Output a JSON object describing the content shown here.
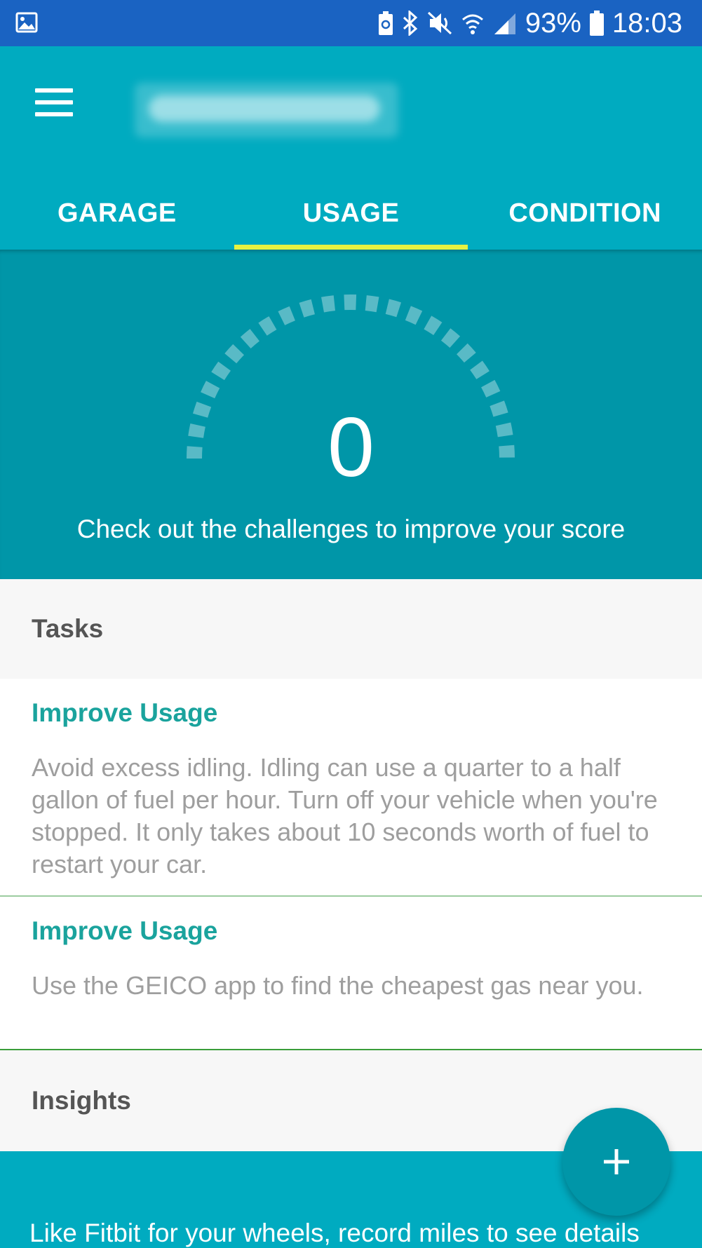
{
  "status_bar": {
    "battery_percent": "93%",
    "time": "18:03",
    "icons": [
      "image-icon",
      "battery-saver-icon",
      "bluetooth-icon",
      "mute-icon",
      "wifi-icon",
      "signal-icon",
      "battery-icon"
    ]
  },
  "colors": {
    "status_bar": "#1a63c2",
    "app_bar": "#00abc0",
    "score_area": "#0096a8",
    "tab_indicator": "#e8f241",
    "task_title": "#1aa39d"
  },
  "tabs": [
    {
      "label": "GARAGE",
      "active": false
    },
    {
      "label": "USAGE",
      "active": true
    },
    {
      "label": "CONDITION",
      "active": false
    }
  ],
  "score": {
    "value": "0",
    "message": "Check out the challenges to improve your score"
  },
  "tasks": {
    "header": "Tasks",
    "items": [
      {
        "title": "Improve Usage",
        "description": "Avoid excess idling. Idling can use a quarter to a half gallon of fuel per hour. Turn off your vehicle when you're stopped. It only takes about 10 seconds worth of fuel to restart your car."
      },
      {
        "title": "Improve Usage",
        "description": "Use the GEICO app to find the cheapest gas near you."
      }
    ]
  },
  "insights": {
    "header": "Insights",
    "banner_text": "Like Fitbit for your wheels, record miles to see details"
  },
  "fab": {
    "icon": "plus-icon",
    "symbol": "+"
  }
}
